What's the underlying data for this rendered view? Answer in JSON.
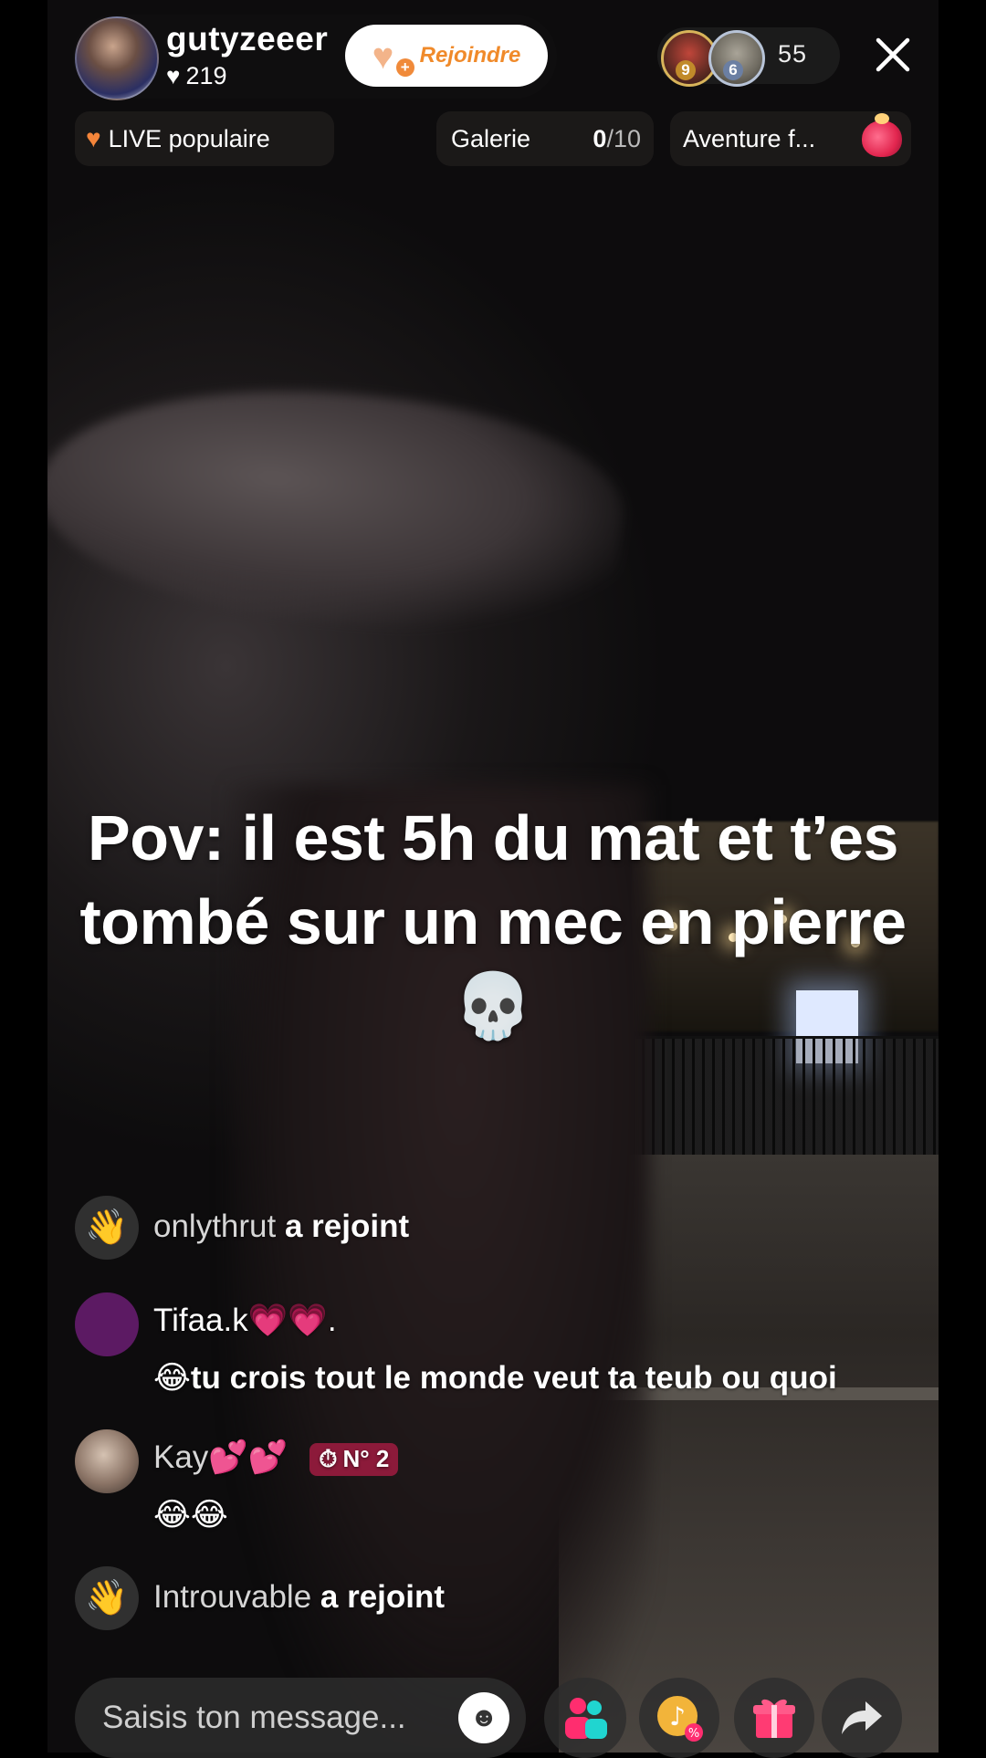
{
  "host": {
    "name": "gutyzeeer",
    "likes": "219",
    "join_label": "Rejoindre"
  },
  "viewers": {
    "count": "55",
    "ranks": [
      "9",
      "6"
    ]
  },
  "chips": {
    "popular": "LIVE populaire",
    "gallery_label": "Galerie",
    "gallery_value": "0",
    "gallery_total": "/10",
    "adventure": "Aventure f..."
  },
  "caption": {
    "line1": "Pov: il est 5h du mat et t’es",
    "line2": "tombé sur un mec en pierre 💀"
  },
  "chat": {
    "join1_user": "onlythrut",
    "join_suffix": "a rejoint",
    "msg1_user": "Tifaa.k💗💗.",
    "msg1_text": "😂tu crois tout le monde veut ta teub ou quoi",
    "msg2_user": "Kay💕💕",
    "msg2_rank": "N° 2",
    "msg2_text": "😂😂",
    "join2_user": "Introuvable"
  },
  "bottom": {
    "placeholder": "Saisis ton message..."
  },
  "colors": {
    "accent_orange": "#f08a2a",
    "rank_chip": "#8c1a3a"
  }
}
